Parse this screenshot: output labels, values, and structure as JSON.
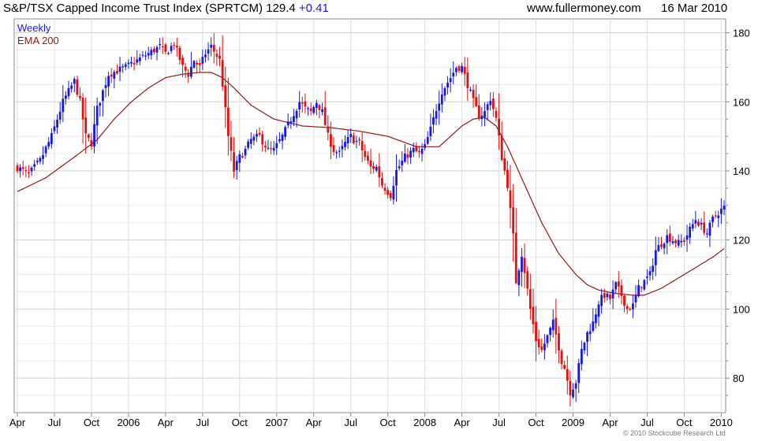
{
  "header": {
    "title": "S&P/TSX Capped Income Trust Index (SPRTCM)",
    "last": "129.4",
    "change": "+0.41",
    "site": "www.fullermoney.com",
    "date": "16 Mar 2010"
  },
  "copyright": "© 2010 Stockcube Research Ltd",
  "colors": {
    "up": "#1a1ad6",
    "down": "#e01010",
    "ema": "#8b1a1a",
    "grid": "#d7d7d7",
    "frame": "#888888"
  },
  "chart_data": {
    "type": "candlestick",
    "legend": [
      "Weekly",
      "EMA 200"
    ],
    "ylim": [
      70,
      184
    ],
    "yticks": [
      80,
      100,
      120,
      140,
      160,
      180
    ],
    "xticks": [
      {
        "label": "Apr",
        "t": 0
      },
      {
        "label": "Jul",
        "t": 13
      },
      {
        "label": "Oct",
        "t": 26
      },
      {
        "label": "2006",
        "t": 39
      },
      {
        "label": "Apr",
        "t": 52
      },
      {
        "label": "Jul",
        "t": 65
      },
      {
        "label": "Oct",
        "t": 78
      },
      {
        "label": "2007",
        "t": 91
      },
      {
        "label": "Apr",
        "t": 104
      },
      {
        "label": "Jul",
        "t": 117
      },
      {
        "label": "Oct",
        "t": 130
      },
      {
        "label": "2008",
        "t": 143
      },
      {
        "label": "Apr",
        "t": 156
      },
      {
        "label": "Jul",
        "t": 169
      },
      {
        "label": "Oct",
        "t": 182
      },
      {
        "label": "2009",
        "t": 195
      },
      {
        "label": "Apr",
        "t": 208
      },
      {
        "label": "Jul",
        "t": 221
      },
      {
        "label": "Oct",
        "t": 234
      },
      {
        "label": "2010",
        "t": 247
      }
    ],
    "close_anchors": [
      [
        0,
        141
      ],
      [
        4,
        139
      ],
      [
        8,
        143
      ],
      [
        12,
        150
      ],
      [
        16,
        160
      ],
      [
        20,
        166
      ],
      [
        22,
        160
      ],
      [
        24,
        150
      ],
      [
        26,
        148
      ],
      [
        28,
        158
      ],
      [
        32,
        168
      ],
      [
        38,
        170
      ],
      [
        42,
        172
      ],
      [
        46,
        174
      ],
      [
        50,
        176
      ],
      [
        52,
        174
      ],
      [
        55,
        177
      ],
      [
        58,
        170
      ],
      [
        60,
        168
      ],
      [
        62,
        172
      ],
      [
        64,
        170
      ],
      [
        66,
        174
      ],
      [
        68,
        176
      ],
      [
        71,
        172
      ],
      [
        72,
        165
      ],
      [
        74,
        150
      ],
      [
        76,
        140
      ],
      [
        78,
        144
      ],
      [
        80,
        146
      ],
      [
        82,
        149
      ],
      [
        85,
        150
      ],
      [
        88,
        146
      ],
      [
        90,
        146
      ],
      [
        93,
        150
      ],
      [
        96,
        155
      ],
      [
        99,
        160
      ],
      [
        101,
        158
      ],
      [
        103,
        157
      ],
      [
        105,
        160
      ],
      [
        107,
        157
      ],
      [
        109,
        150
      ],
      [
        111,
        146
      ],
      [
        113,
        145
      ],
      [
        115,
        148
      ],
      [
        117,
        150
      ],
      [
        118,
        149
      ],
      [
        120,
        148
      ],
      [
        122,
        144
      ],
      [
        124,
        141
      ],
      [
        126,
        141
      ],
      [
        128,
        136
      ],
      [
        131,
        133
      ],
      [
        133,
        140
      ],
      [
        136,
        144
      ],
      [
        139,
        146
      ],
      [
        141,
        145
      ],
      [
        143,
        147
      ],
      [
        145,
        152
      ],
      [
        147,
        158
      ],
      [
        149,
        163
      ],
      [
        152,
        167
      ],
      [
        154,
        170
      ],
      [
        156,
        170
      ],
      [
        158,
        165
      ],
      [
        160,
        160
      ],
      [
        162,
        156
      ],
      [
        164,
        157
      ],
      [
        166,
        161
      ],
      [
        168,
        155
      ],
      [
        170,
        144
      ],
      [
        172,
        136
      ],
      [
        174,
        121
      ],
      [
        175,
        108
      ],
      [
        177,
        116
      ],
      [
        178,
        111
      ],
      [
        180,
        100
      ],
      [
        182,
        91
      ],
      [
        184,
        88
      ],
      [
        186,
        92
      ],
      [
        188,
        96
      ],
      [
        190,
        89
      ],
      [
        191,
        85
      ],
      [
        192,
        83
      ],
      [
        194,
        76
      ],
      [
        196,
        79
      ],
      [
        198,
        88
      ],
      [
        200,
        93
      ],
      [
        202,
        96
      ],
      [
        204,
        102
      ],
      [
        206,
        104
      ],
      [
        208,
        103
      ],
      [
        210,
        107
      ],
      [
        212,
        104
      ],
      [
        214,
        100
      ],
      [
        216,
        101
      ],
      [
        218,
        106
      ],
      [
        220,
        108
      ],
      [
        222,
        110
      ],
      [
        224,
        117
      ],
      [
        226,
        119
      ],
      [
        228,
        121
      ],
      [
        230,
        120
      ],
      [
        232,
        119
      ],
      [
        234,
        120
      ],
      [
        236,
        123
      ],
      [
        238,
        126
      ],
      [
        240,
        124
      ],
      [
        242,
        122
      ],
      [
        244,
        126
      ],
      [
        246,
        128
      ],
      [
        248,
        129.4
      ]
    ],
    "ema_anchors": [
      [
        0,
        134
      ],
      [
        10,
        138
      ],
      [
        20,
        144
      ],
      [
        28,
        149
      ],
      [
        34,
        155
      ],
      [
        40,
        160
      ],
      [
        46,
        164
      ],
      [
        52,
        167
      ],
      [
        58,
        168
      ],
      [
        64,
        168.5
      ],
      [
        68,
        168.5
      ],
      [
        72,
        167
      ],
      [
        76,
        164
      ],
      [
        82,
        159
      ],
      [
        90,
        155
      ],
      [
        100,
        153
      ],
      [
        110,
        152.5
      ],
      [
        120,
        151.5
      ],
      [
        130,
        150
      ],
      [
        140,
        147
      ],
      [
        148,
        147
      ],
      [
        152,
        150
      ],
      [
        156,
        153
      ],
      [
        160,
        155
      ],
      [
        164,
        155.5
      ],
      [
        168,
        153
      ],
      [
        172,
        147
      ],
      [
        178,
        136
      ],
      [
        184,
        125
      ],
      [
        190,
        116
      ],
      [
        196,
        110
      ],
      [
        200,
        107
      ],
      [
        204,
        105.5
      ],
      [
        210,
        104.5
      ],
      [
        216,
        104
      ],
      [
        220,
        104
      ],
      [
        226,
        106
      ],
      [
        232,
        109
      ],
      [
        238,
        112
      ],
      [
        244,
        115
      ],
      [
        248,
        117.5
      ]
    ]
  }
}
